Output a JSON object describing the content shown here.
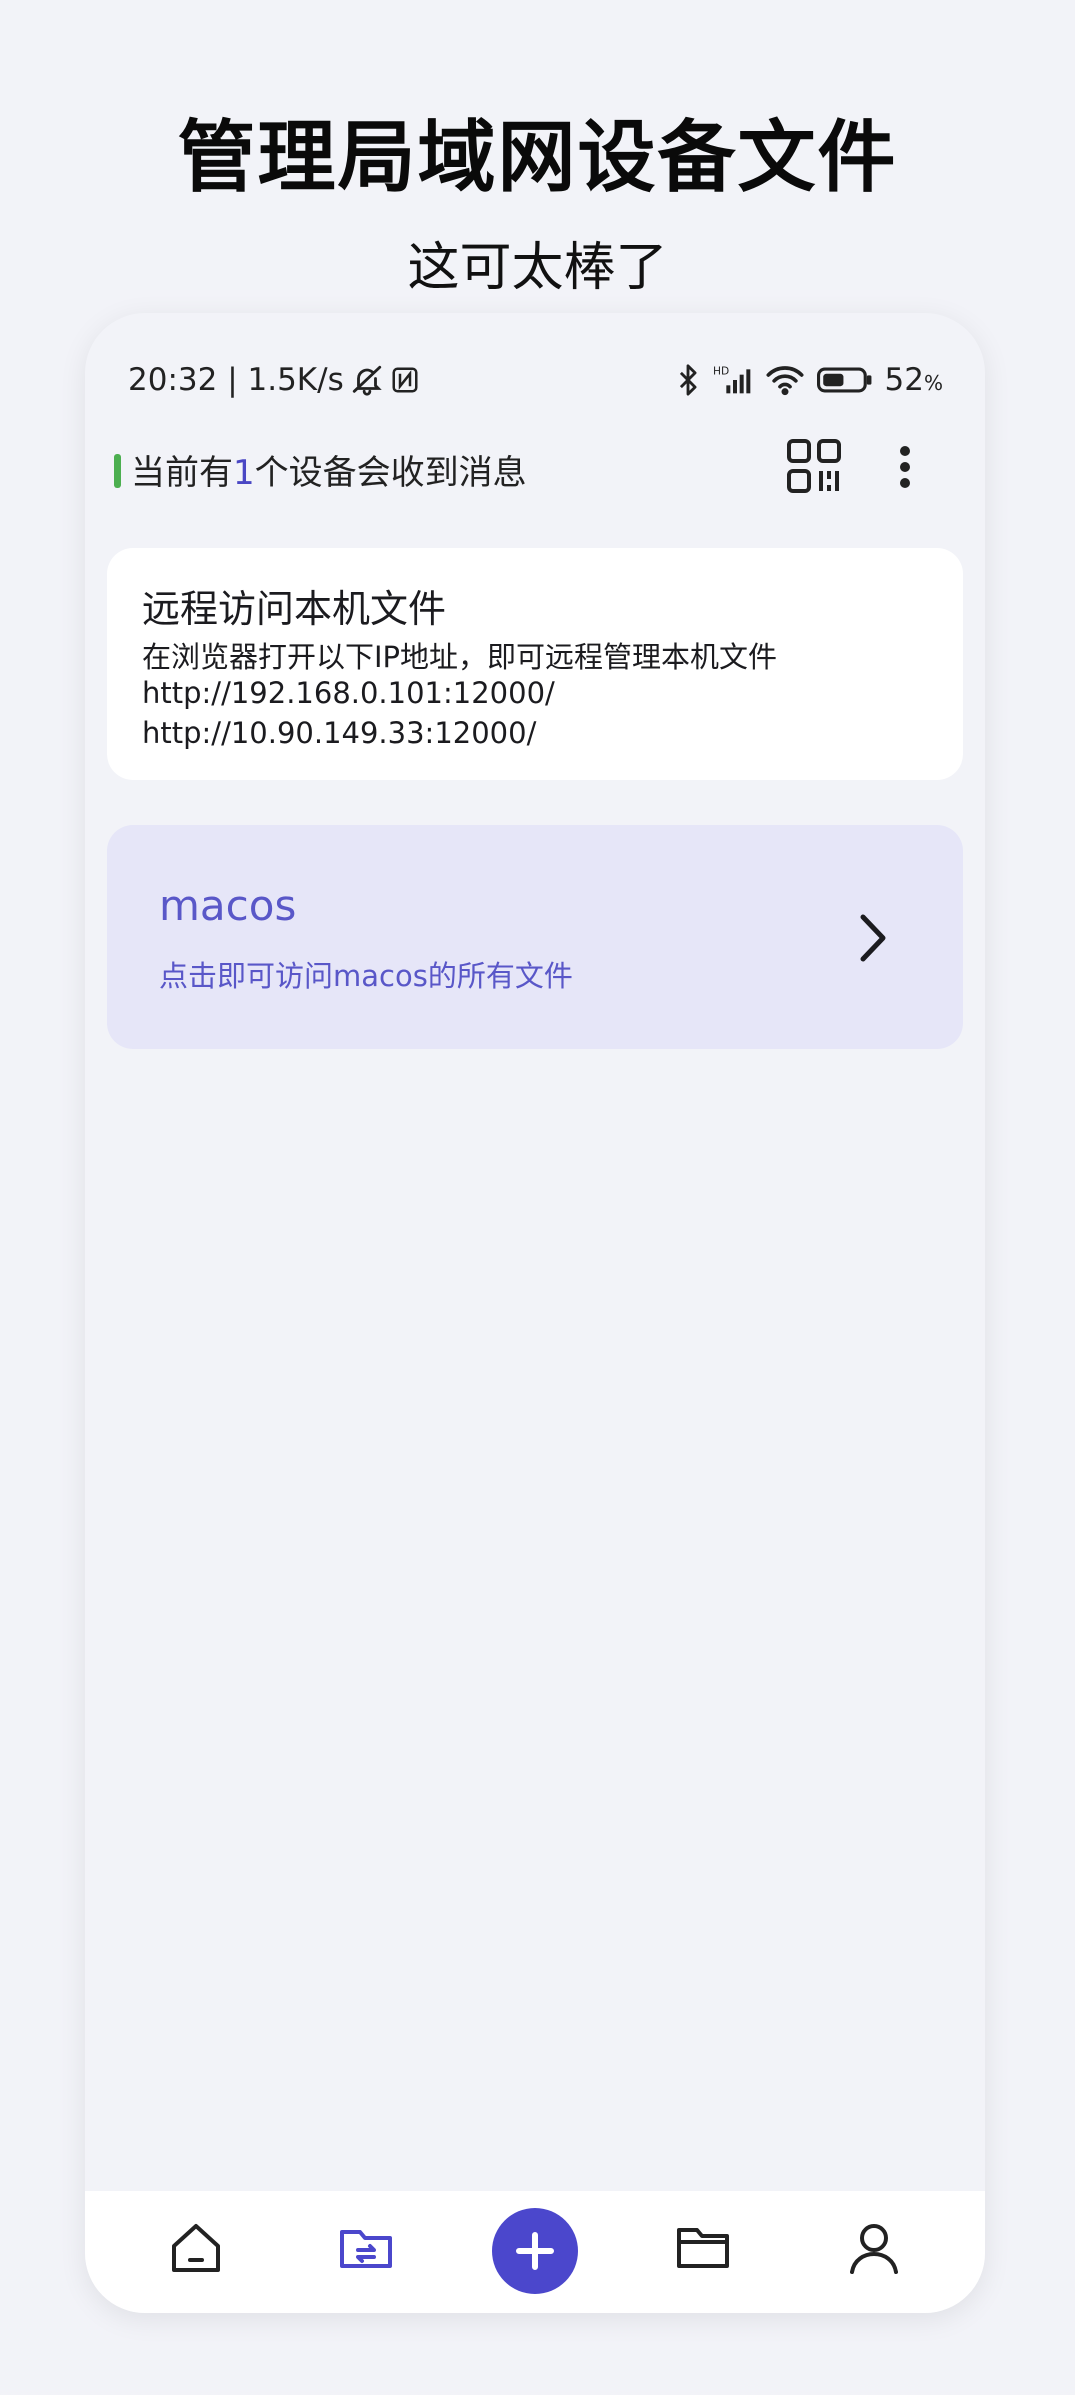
{
  "promo": {
    "headline": "管理局域网设备文件",
    "subline": "这可太棒了"
  },
  "statusbar": {
    "time_speed": "20:32 | 1.5K/s",
    "battery": "52",
    "battery_unit": "%",
    "icons": [
      "mute-bell-icon",
      "nfc-icon",
      "bluetooth-icon",
      "hd-signal-icon",
      "wifi-icon",
      "battery-icon"
    ]
  },
  "appbar": {
    "title_prefix": "当前有",
    "device_count": "1",
    "title_suffix": "个设备会收到消息",
    "indicator_color": "#4caf50"
  },
  "remote_card": {
    "title": "远程访问本机文件",
    "description": "在浏览器打开以下IP地址，即可远程管理本机文件",
    "urls": [
      "http://192.168.0.101:12000/",
      "http://10.90.149.33:12000/"
    ]
  },
  "device_card": {
    "name": "macos",
    "description": "点击即可访问macos的所有文件",
    "accent_color": "#5957c8"
  },
  "bottom_nav": {
    "items": [
      "home-icon",
      "transfer-folder-icon",
      "add-icon",
      "folder-icon",
      "profile-icon"
    ],
    "active": "transfer-folder-icon",
    "accent_color": "#4b47cc"
  }
}
